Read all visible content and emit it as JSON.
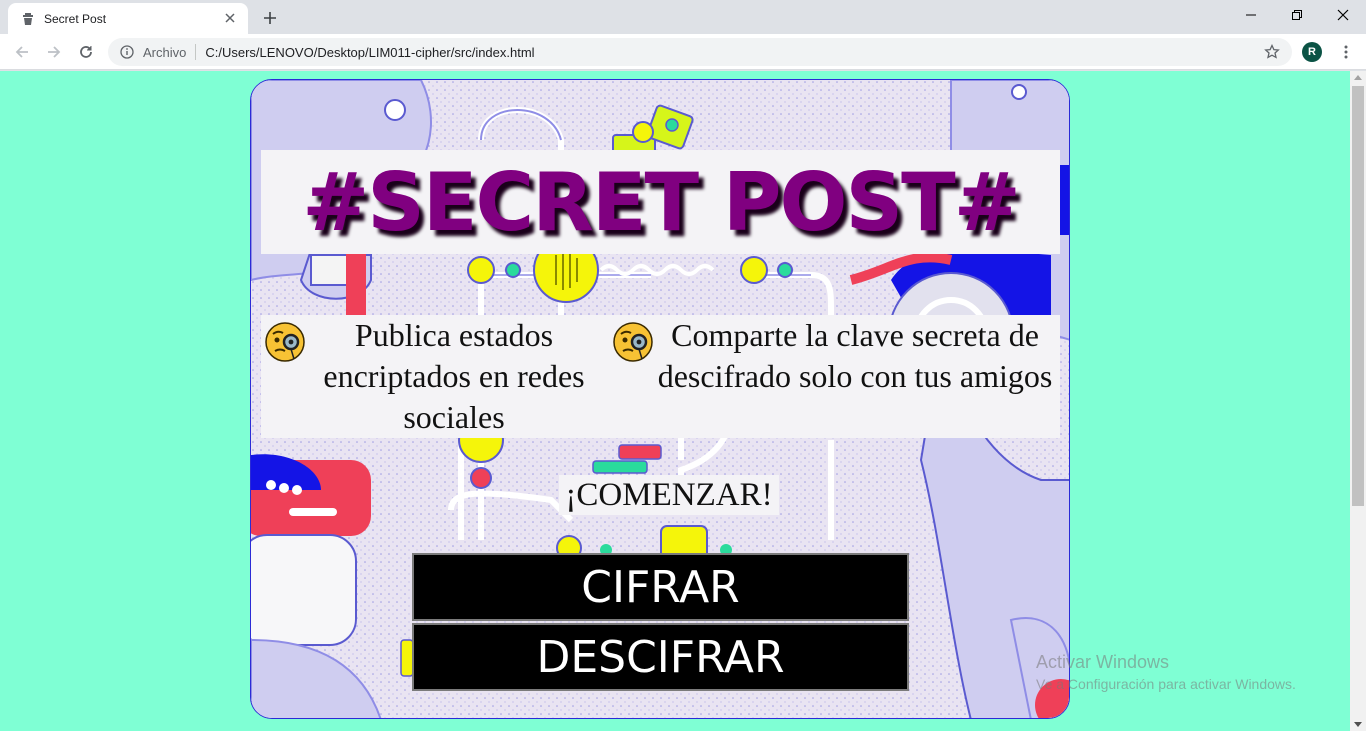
{
  "browser": {
    "tab_title": "Secret Post",
    "address_scheme": "Archivo",
    "address_url": "C:/Users/LENOVO/Desktop/LIM011-cipher/src/index.html",
    "profile_initial": "R"
  },
  "page": {
    "title": "#SECRET POST#",
    "feature_1": "Publica estados encriptados en redes sociales",
    "feature_2": "Comparte la clave secreta de descifrado solo con tus amigos",
    "feature_icon": "face-with-monocle-icon",
    "start_label": "¡COMENZAR!",
    "encrypt_button": "CIFRAR",
    "decrypt_button": "DESCIFRAR"
  },
  "os_watermark": {
    "line1": "Activar Windows",
    "line2": "Ve a Configuración para activar Windows."
  },
  "colors": {
    "page_background": "#7fffd4",
    "title": "#800080",
    "button_bg": "#000000",
    "button_text": "#ffffff"
  }
}
